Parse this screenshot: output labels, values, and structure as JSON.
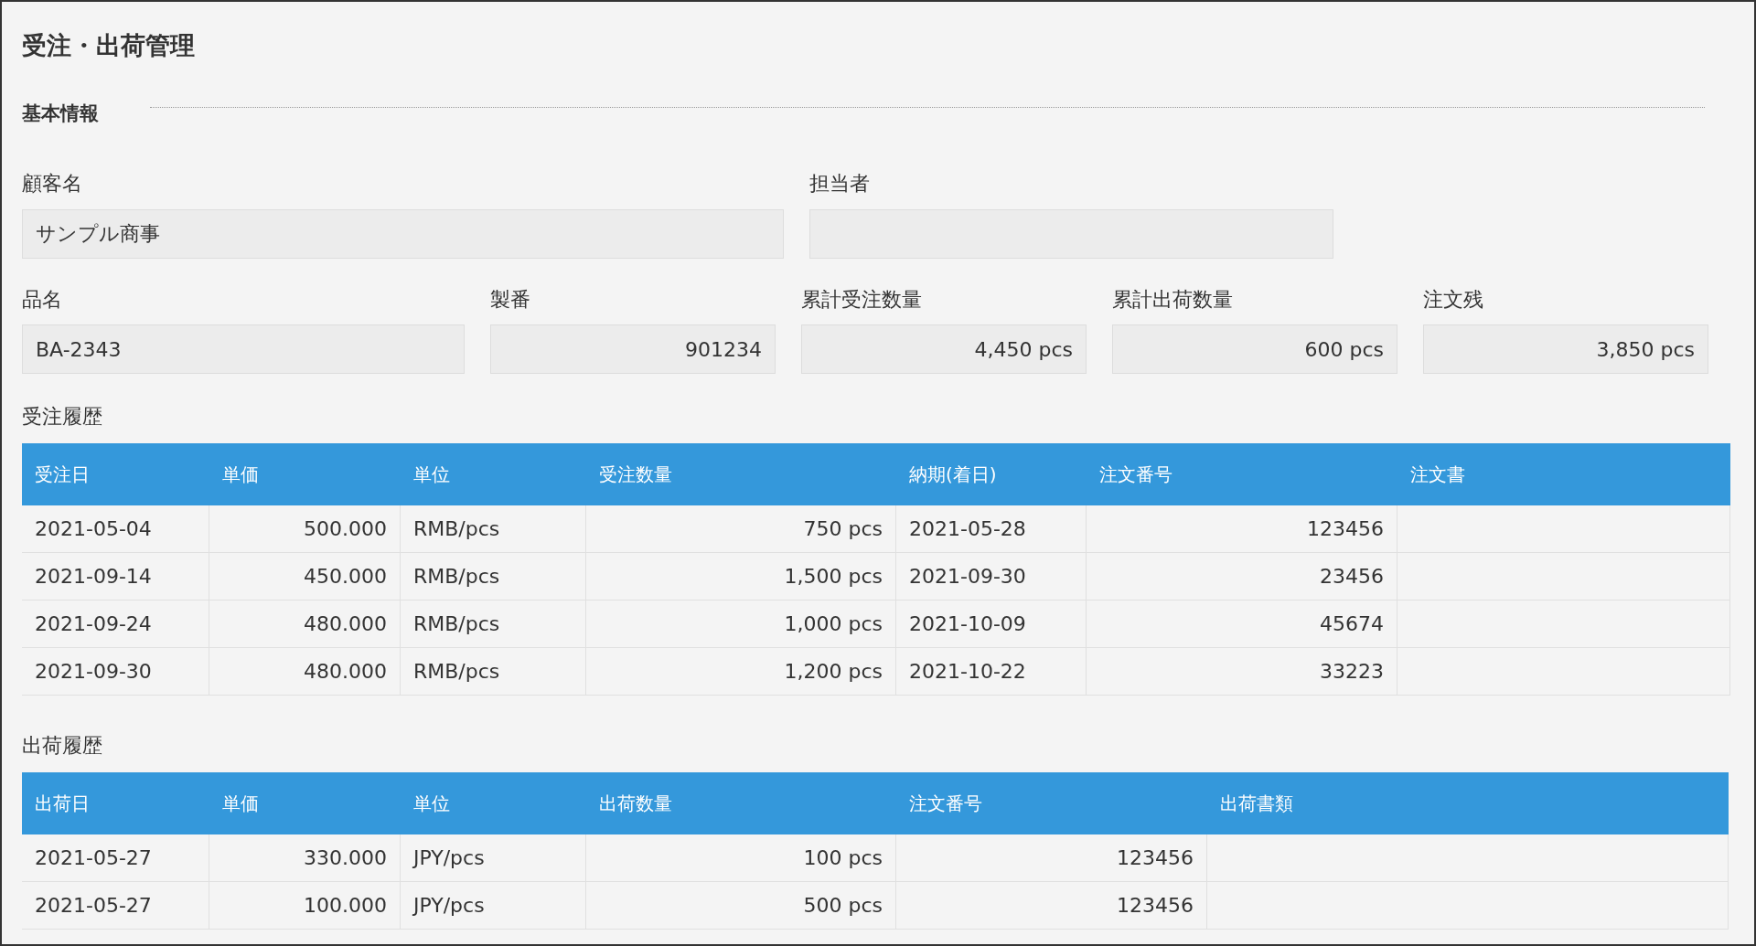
{
  "title": "受注・出荷管理",
  "section": {
    "title": "基本情報"
  },
  "field_rows": [
    [
      {
        "label": "顧客名",
        "value": "サンプル商事"
      },
      {
        "label": "担当者"
      }
    ],
    [
      {
        "label": "品名",
        "value": "BA-2343"
      },
      {
        "label": "製番",
        "value": "901234"
      },
      {
        "label": "累計受注数量",
        "value": "4,450 pcs"
      },
      {
        "label": "累計出荷数量",
        "value": "600 pcs"
      },
      {
        "label": "注文残",
        "value": "3,850 pcs"
      }
    ]
  ],
  "tables": [
    {
      "title": "受注履歴",
      "columns": [
        "受注日",
        "単価",
        "単位",
        "受注数量",
        "納期(着日)",
        "注文番号",
        "注文書"
      ],
      "rows": [
        [
          "2021-05-04",
          "500.000",
          "RMB/pcs",
          "750 pcs",
          "2021-05-28",
          "123456"
        ],
        [
          "2021-09-14",
          "450.000",
          "RMB/pcs",
          "1,500 pcs",
          "2021-09-30",
          "23456"
        ],
        [
          "2021-09-24",
          "480.000",
          "RMB/pcs",
          "1,000 pcs",
          "2021-10-09",
          "45674"
        ],
        [
          "2021-09-30",
          "480.000",
          "RMB/pcs",
          "1,200 pcs",
          "2021-10-22",
          "33223"
        ]
      ]
    },
    {
      "title": "出荷履歴",
      "columns": [
        "出荷日",
        "単価",
        "単位",
        "出荷数量",
        "注文番号",
        "出荷書類"
      ],
      "rows": [
        [
          "2021-05-27",
          "330.000",
          "JPY/pcs",
          "100 pcs",
          "123456"
        ],
        [
          "2021-05-27",
          "100.000",
          "JPY/pcs",
          "500 pcs",
          "123456"
        ]
      ]
    }
  ]
}
